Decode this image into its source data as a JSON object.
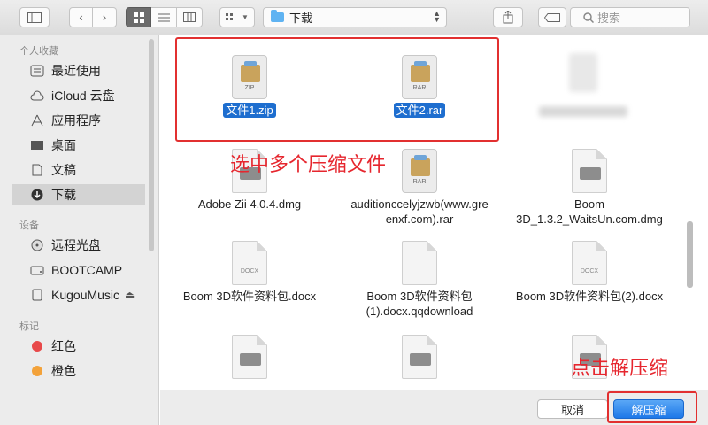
{
  "toolbar": {
    "sidebar_toggle_icon": "sidebar-icon",
    "back_icon": "chevron-left-icon",
    "forward_icon": "chevron-right-icon",
    "view_modes": [
      "icon-view",
      "list-view",
      "column-view"
    ],
    "active_view": "icon-view",
    "arrange_icon": "arrange-icon",
    "path_label": "下载",
    "share_icon": "share-icon",
    "tag_icon": "tag-icon",
    "search_placeholder": "搜索"
  },
  "sidebar": {
    "favorites_header": "个人收藏",
    "favorites": [
      {
        "label": "最近使用",
        "icon": "recents-icon"
      },
      {
        "label": "iCloud 云盘",
        "icon": "cloud-icon"
      },
      {
        "label": "应用程序",
        "icon": "applications-icon"
      },
      {
        "label": "桌面",
        "icon": "desktop-icon"
      },
      {
        "label": "文稿",
        "icon": "documents-icon"
      },
      {
        "label": "下载",
        "icon": "download-icon",
        "active": true
      }
    ],
    "devices_header": "设备",
    "devices": [
      {
        "label": "远程光盘",
        "icon": "disc-icon"
      },
      {
        "label": "BOOTCAMP",
        "icon": "drive-icon"
      },
      {
        "label": "KugouMusic",
        "icon": "drive-icon",
        "eject": "⏏"
      }
    ],
    "tags_header": "标记",
    "tags": [
      {
        "label": "红色",
        "color": "#e8494a"
      },
      {
        "label": "橙色",
        "color": "#f3a23a"
      }
    ]
  },
  "files": [
    {
      "name": "文件1.zip",
      "type": "zip",
      "badge": "ZIP",
      "selected": true
    },
    {
      "name": "文件2.rar",
      "type": "rar",
      "badge": "RAR",
      "selected": true
    },
    {
      "name": "",
      "type": "blurred"
    },
    {
      "name": "Adobe Zii 4.0.4.dmg",
      "type": "dmg"
    },
    {
      "name": "auditionccelyjzwb(www.gre\nenxf.com).rar",
      "type": "rar",
      "badge": "RAR"
    },
    {
      "name": "Boom\n3D_1.3.2_WaitsUn.com.dmg",
      "type": "dmg"
    },
    {
      "name": "Boom 3D软件资料包.docx",
      "type": "docx",
      "badge": "DOCX"
    },
    {
      "name": "Boom 3D软件资料包\n(1).docx.qqdownload",
      "type": "blank"
    },
    {
      "name": "Boom 3D软件资料包(2).docx",
      "type": "docx",
      "badge": "DOCX"
    }
  ],
  "footer": {
    "cancel_label": "取消",
    "primary_label": "解压缩"
  },
  "annotations": {
    "select_text": "选中多个压缩文件",
    "click_text": "点击解压缩",
    "color": "#e23030"
  }
}
